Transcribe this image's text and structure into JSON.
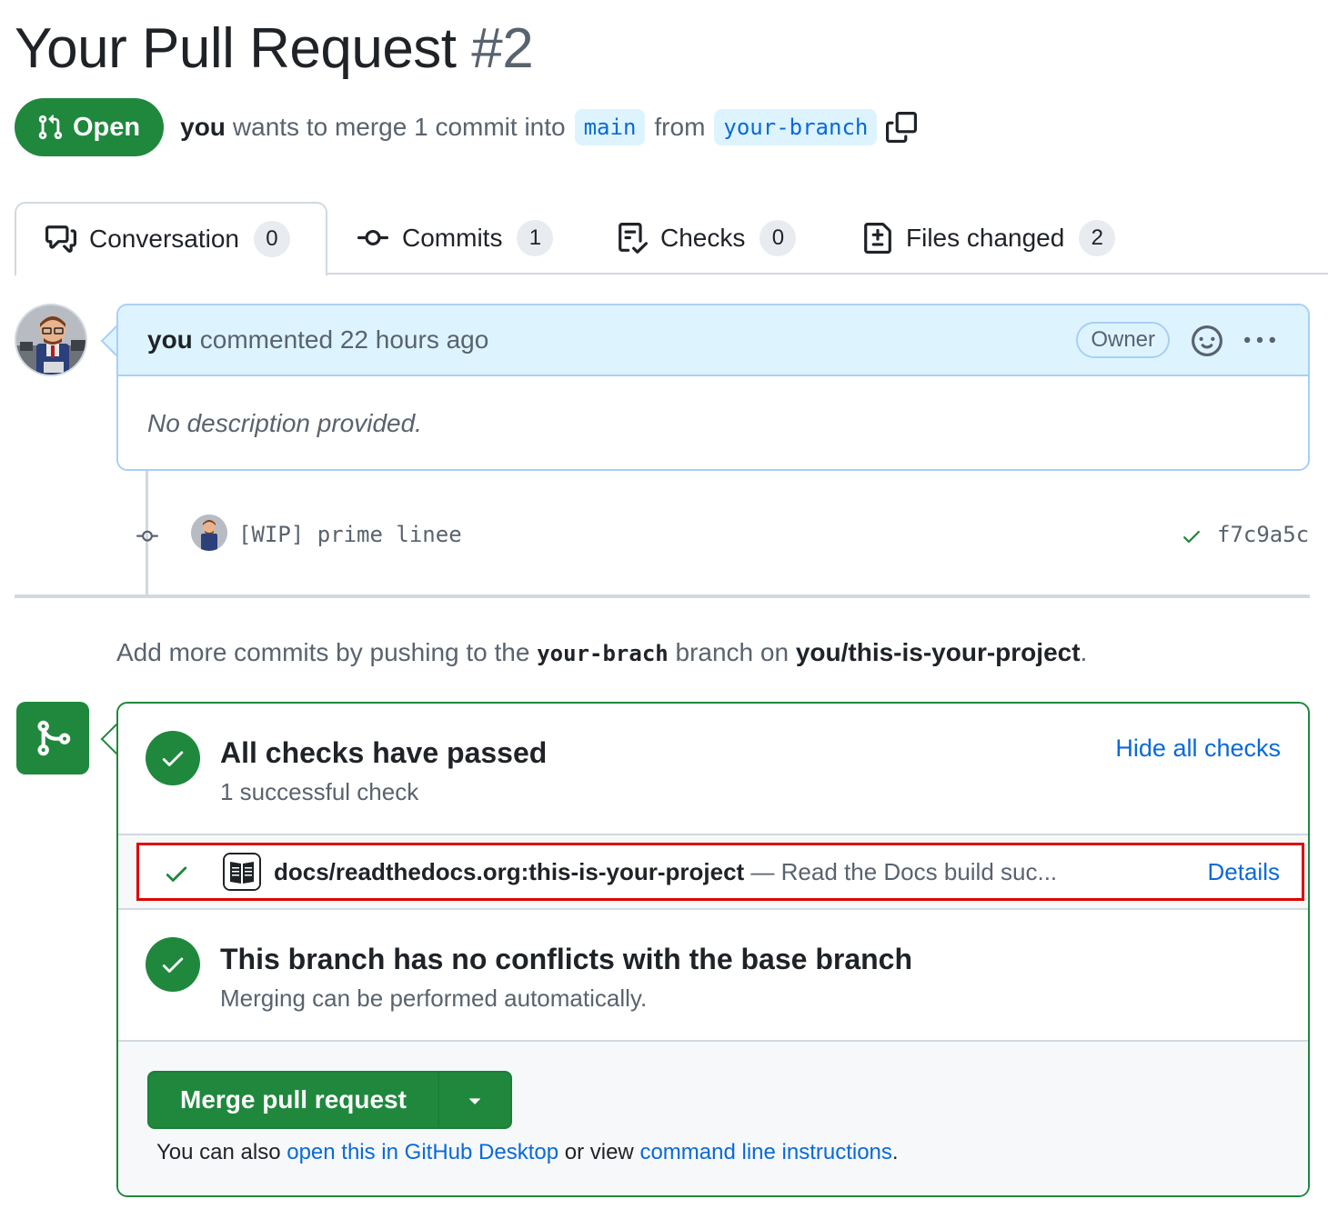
{
  "header": {
    "title": "Your Pull Request",
    "number": "#2",
    "state": "Open",
    "author": "you",
    "summary": "wants to merge 1 commit into",
    "base_branch": "main",
    "from_word": "from",
    "head_branch": "your-branch"
  },
  "tabs": [
    {
      "label": "Conversation",
      "count": "0",
      "icon": "comment-discussion-icon",
      "active": true
    },
    {
      "label": "Commits",
      "count": "1",
      "icon": "git-commit-icon",
      "active": false
    },
    {
      "label": "Checks",
      "count": "0",
      "icon": "checklist-icon",
      "active": false
    },
    {
      "label": "Files changed",
      "count": "2",
      "icon": "file-diff-icon",
      "active": false
    }
  ],
  "comment": {
    "author": "you",
    "action": "commented 22 hours ago",
    "role": "Owner",
    "body": "No description provided."
  },
  "commit": {
    "message": "[WIP] prime linee",
    "sha": "f7c9a5c"
  },
  "push_hint": {
    "prefix": "Add more commits by pushing to the",
    "branch": "your-brach",
    "middle": "branch on",
    "repo": "you/this-is-your-project",
    "suffix": "."
  },
  "checks": {
    "title": "All checks have passed",
    "subtitle": "1 successful check",
    "hide_link": "Hide all checks",
    "item_name": "docs/readthedocs.org:this-is-your-project",
    "item_desc": "— Read the Docs build suc...",
    "details_link": "Details"
  },
  "conflicts": {
    "title": "This branch has no conflicts with the base branch",
    "subtitle": "Merging can be performed automatically."
  },
  "merge": {
    "button_label": "Merge pull request",
    "also_prefix": "You can also",
    "desktop_link": "open this in GitHub Desktop",
    "or_view": "or view",
    "cli_link": "command line instructions",
    "suffix": "."
  },
  "colors": {
    "success": "#1f883d",
    "link": "#0969da",
    "highlight": "#e00000",
    "comment_header": "#ddf4ff"
  }
}
